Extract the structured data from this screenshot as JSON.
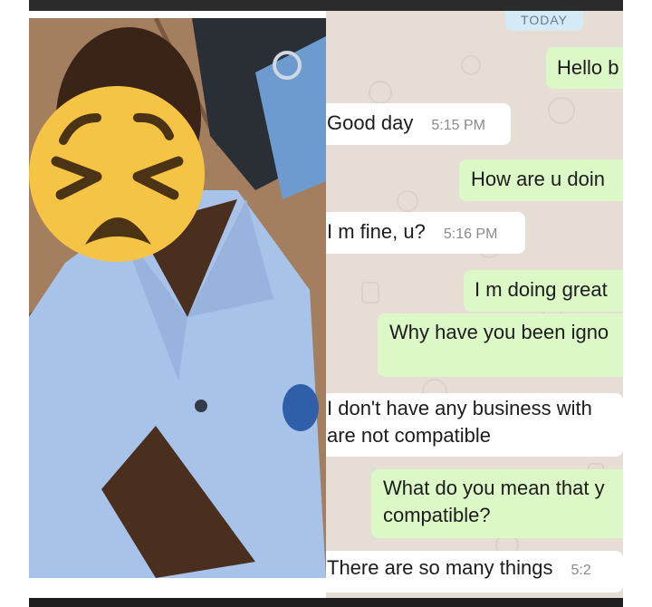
{
  "chat": {
    "date_chip": "TODAY",
    "messages": [
      {
        "dir": "out",
        "text": "Hello b",
        "time": ""
      },
      {
        "dir": "in",
        "text": "Good day",
        "time": "5:15 PM"
      },
      {
        "dir": "out",
        "text": "How are u doin",
        "time": ""
      },
      {
        "dir": "in",
        "text": "I m fine, u?",
        "time": "5:16 PM"
      },
      {
        "dir": "out",
        "text": "I m doing great",
        "time": ""
      },
      {
        "dir": "out",
        "text": "Why have you been igno",
        "time": ""
      },
      {
        "dir": "in",
        "line1": "I don't have any business with",
        "line2": "are not compatible",
        "time": ""
      },
      {
        "dir": "out",
        "line1": "What do you mean that y",
        "line2": "compatible?",
        "time": ""
      },
      {
        "dir": "in",
        "text": "There are so many things",
        "time": "5:2"
      }
    ]
  },
  "colors": {
    "incoming_bubble": "#ffffff",
    "outgoing_bubble": "#dcf8c6",
    "chat_background": "#e6ddd4",
    "emoji_face": "#f6c445"
  },
  "photo": {
    "emoji_overlay": "persevering-face-emoji"
  }
}
